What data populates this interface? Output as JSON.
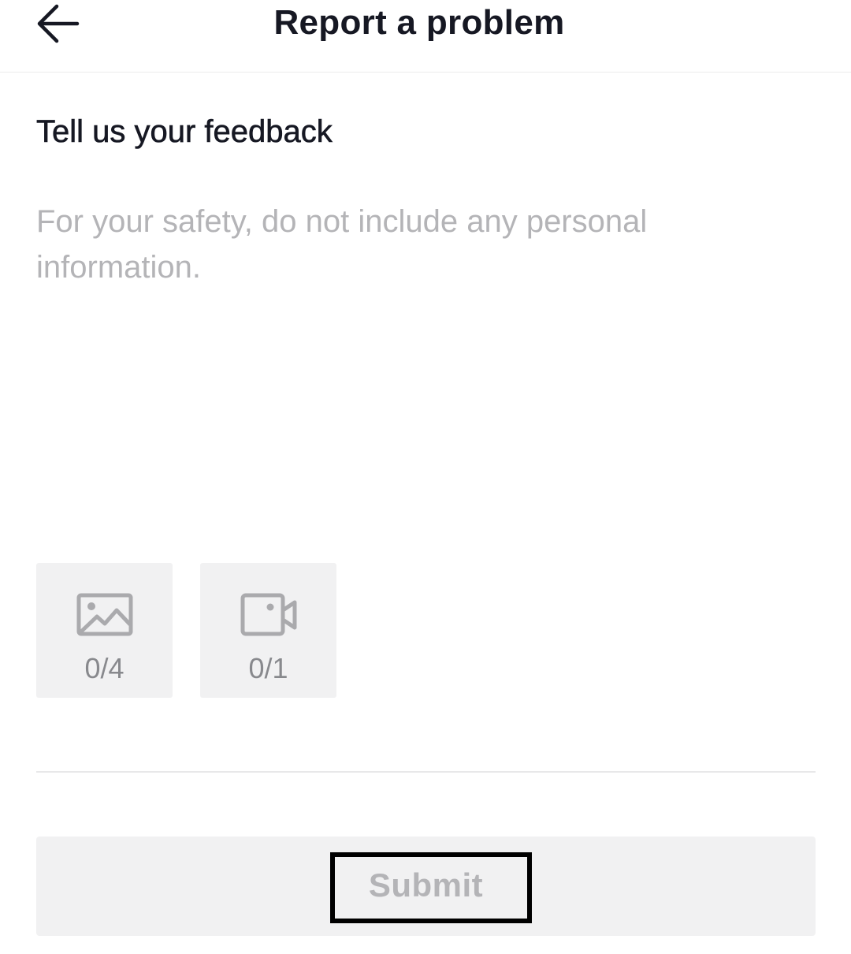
{
  "header": {
    "title": "Report a problem",
    "back_icon": "arrow-left-icon"
  },
  "feedback": {
    "heading": "Tell us your feedback",
    "value": "",
    "placeholder": "For your safety, do not include any personal information."
  },
  "attachments": {
    "photo": {
      "icon": "image-icon",
      "count": "0/4"
    },
    "video": {
      "icon": "video-camera-icon",
      "count": "0/1"
    }
  },
  "submit": {
    "label": "Submit",
    "enabled": false
  },
  "colors": {
    "text_primary": "#161823",
    "placeholder": "#b4b4b7",
    "tile_bg": "#f1f1f2",
    "icon_gray": "#aaaaad",
    "count_gray": "#88898d"
  }
}
